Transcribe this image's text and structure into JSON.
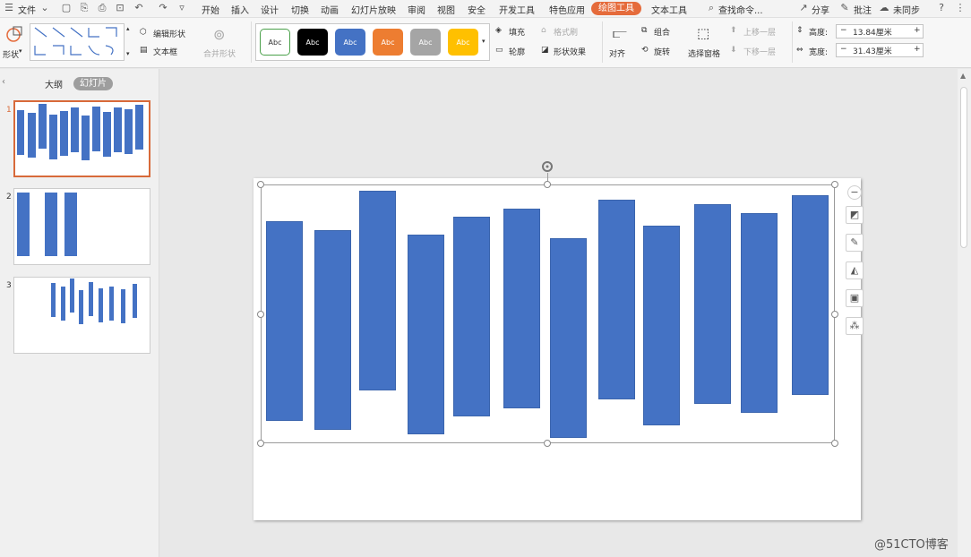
{
  "menubar": {
    "file": "文件",
    "tabs": [
      "开始",
      "插入",
      "设计",
      "切换",
      "动画",
      "幻灯片放映",
      "审阅",
      "视图",
      "安全",
      "开发工具",
      "特色应用",
      "绘图工具",
      "文本工具"
    ],
    "active_tab": "绘图工具",
    "search": "查找命令...",
    "share": "分享",
    "comment": "批注",
    "sync": "未同步",
    "help": "?"
  },
  "ribbon": {
    "shape": "形状",
    "edit_shape": "编辑形状",
    "text_box": "文本框",
    "merge_shape": "合并形状",
    "style_samples": [
      {
        "label": "Abc",
        "bg": "#ffffff",
        "fg": "#333333",
        "border": "#4aa04a"
      },
      {
        "label": "Abc",
        "bg": "#000000",
        "fg": "#ffffff",
        "border": "#000000"
      },
      {
        "label": "Abc",
        "bg": "#4472c4",
        "fg": "#ffffff",
        "border": "#4472c4"
      },
      {
        "label": "Abc",
        "bg": "#ed7d31",
        "fg": "#ffffff",
        "border": "#ed7d31"
      },
      {
        "label": "Abc",
        "bg": "#a5a5a5",
        "fg": "#ffffff",
        "border": "#a5a5a5"
      },
      {
        "label": "Abc",
        "bg": "#ffc000",
        "fg": "#ffffff",
        "border": "#ffc000"
      }
    ],
    "fill": "填充",
    "format_painter": "格式刷",
    "outline": "轮廓",
    "shape_effect": "形状效果",
    "align": "对齐",
    "group": "组合",
    "rotate": "旋转",
    "select_pane": "选择窗格",
    "move_up": "上移一层",
    "move_down": "下移一层",
    "height_label": "高度:",
    "height_value": "13.84厘米",
    "width_label": "宽度:",
    "width_value": "31.43厘米"
  },
  "panel": {
    "outline_tab": "大纲",
    "slides_tab": "幻灯片",
    "slide_numbers": [
      "1",
      "2",
      "3"
    ]
  },
  "slide": {
    "bar_color": "#4472c4"
  },
  "watermark": "@51CTO博客"
}
